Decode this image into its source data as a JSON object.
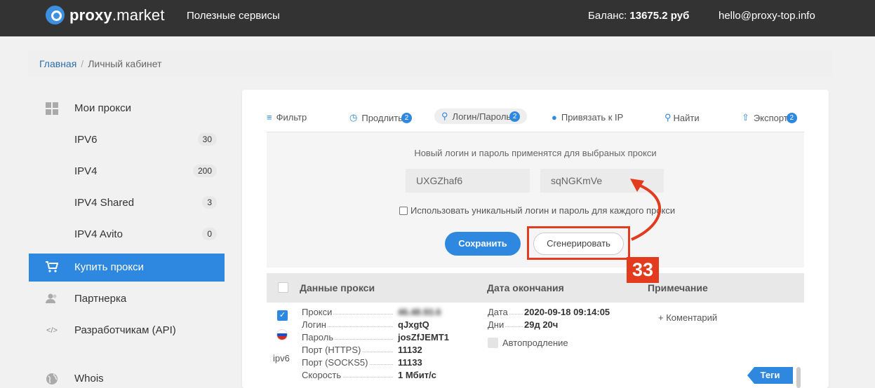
{
  "header": {
    "logo_bold": "proxy",
    "logo_rest": ".market",
    "nav_link": "Полезные сервисы",
    "balance_label": "Баланс:",
    "balance_value": "13675.2 руб",
    "email": "hello@proxy-top.info"
  },
  "breadcrumb": {
    "home": "Главная",
    "separator": "/",
    "current": "Личный кабинет"
  },
  "sidebar": {
    "items": [
      {
        "label": "Мои прокси",
        "icon": "grid-icon"
      },
      {
        "label": "IPV6",
        "count": "30"
      },
      {
        "label": "IPV4",
        "count": "200"
      },
      {
        "label": "IPV4 Shared",
        "count": "3"
      },
      {
        "label": "IPV4 Avito",
        "count": "0"
      },
      {
        "label": "Купить прокси",
        "icon": "cart-icon",
        "active": true
      },
      {
        "label": "Партнерка",
        "icon": "users-icon"
      },
      {
        "label": "Разработчикам (API)",
        "icon": "code-icon"
      },
      {
        "label": "Whois",
        "icon": "globe-icon"
      }
    ]
  },
  "toolbar": {
    "filter": "Фильтр",
    "extend": "Продлить",
    "extend_badge": "2",
    "login_pass": "Логин/Пароль",
    "login_pass_badge": "2",
    "bind_ip": "Привязать к IP",
    "find": "Найти",
    "export": "Экспорт",
    "export_badge": "2"
  },
  "generator": {
    "hint": "Новый логин и пароль применятся для выбраных прокси",
    "login_value": "UXGZhaf6",
    "password_value": "sqNGKmVe",
    "unique_checkbox_label": "Использовать уникальный логин и пароль для каждого прокси",
    "save_label": "Сохранить",
    "generate_label": "Сгенерировать",
    "step_number": "33"
  },
  "table": {
    "headers": {
      "data": "Данные прокси",
      "expiry": "Дата окончания",
      "note": "Примечание"
    },
    "row": {
      "ip_type": "ipv6",
      "fields": {
        "proxy_label": "Прокси",
        "proxy_value": "46.48.93.6",
        "login_label": "Логин",
        "login_value": "qJxgtQ",
        "password_label": "Пароль",
        "password_value": "josZfJEMT1",
        "https_label": "Порт (HTTPS)",
        "https_value": "11132",
        "socks_label": "Порт (SOCKS5)",
        "socks_value": "11133",
        "speed_label": "Скорость",
        "speed_value": "1 Мбит/с"
      },
      "date_label": "Дата",
      "date_value": "2020-09-18 09:14:05",
      "days_label": "Дни",
      "days_value": "29д 20ч",
      "autorenew_label": "Автопродление",
      "comment": "+ Коментарий",
      "tags": "Теги"
    }
  },
  "colors": {
    "accent": "#2e88e0",
    "highlight": "#e33b1e",
    "topbar": "#333333"
  }
}
